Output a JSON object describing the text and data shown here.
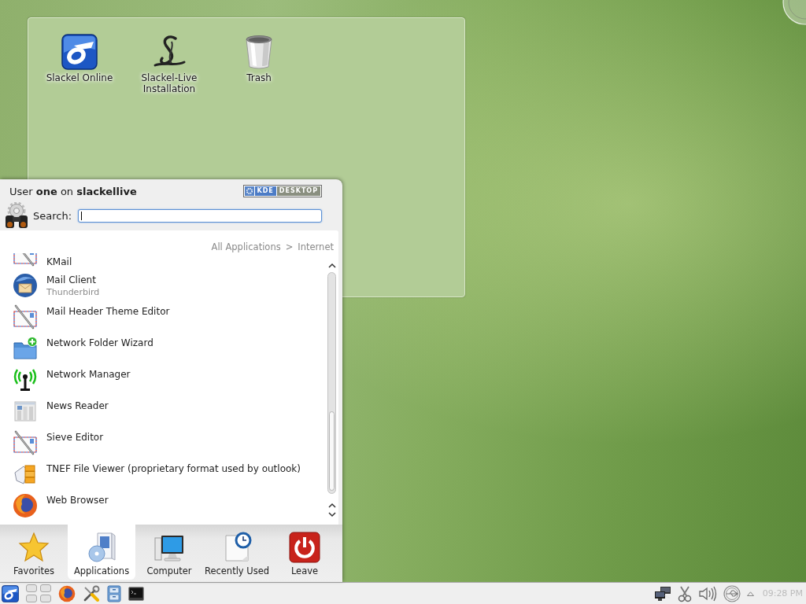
{
  "desktop": {
    "shortcuts": [
      {
        "label": "Slackel Online",
        "kind": "slackel"
      },
      {
        "label": "Slackel-Live Installation",
        "kind": "installer"
      },
      {
        "label": "Trash",
        "kind": "trash"
      }
    ]
  },
  "launcher": {
    "user_line": "User **one** on **slackellive**",
    "badge": {
      "brand": "KDE",
      "product": "DESKTOP"
    },
    "search": {
      "label": "Search:",
      "focused": true
    },
    "breadcrumb": {
      "items": [
        "All Applications",
        "Internet"
      ],
      "separator": ">"
    },
    "apps": [
      {
        "name": "KMail",
        "kind": "mail-editor"
      },
      {
        "name": "Mail Client",
        "subtitle": "Thunderbird",
        "kind": "mail-client"
      },
      {
        "name": "Mail Header Theme Editor",
        "kind": "mail-editor"
      },
      {
        "name": "Network Folder Wizard",
        "kind": "folder-add"
      },
      {
        "name": "Network Manager",
        "kind": "antenna"
      },
      {
        "name": "News Reader",
        "kind": "news"
      },
      {
        "name": "Sieve Editor",
        "kind": "mail-editor"
      },
      {
        "name": "TNEF File Viewer (proprietary format used by outlook)",
        "kind": "tnef"
      },
      {
        "name": "Web Browser",
        "kind": "browser"
      }
    ],
    "tabs": [
      {
        "label": "Favorites",
        "kind": "favorites",
        "selected": false
      },
      {
        "label": "Applications",
        "kind": "applications",
        "selected": true
      },
      {
        "label": "Computer",
        "kind": "computer",
        "selected": false
      },
      {
        "label": "Recently Used",
        "kind": "recent",
        "selected": false
      },
      {
        "label": "Leave",
        "kind": "leave",
        "selected": false
      }
    ]
  },
  "taskbar": {
    "clock": "09:28 PM"
  }
}
